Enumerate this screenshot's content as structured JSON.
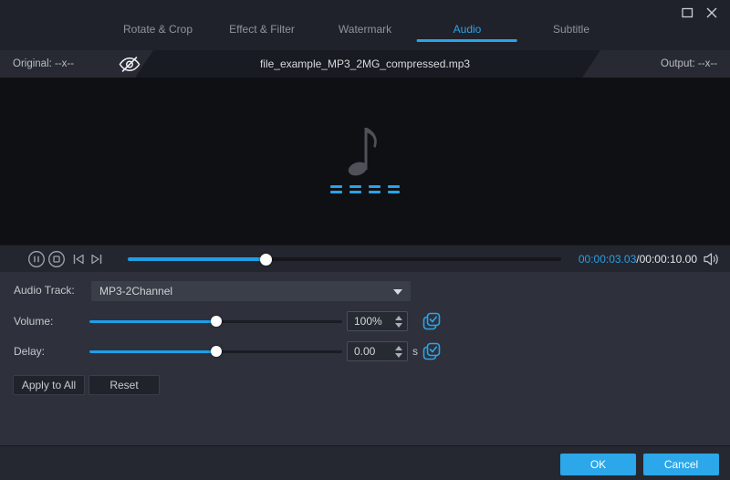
{
  "colors": {
    "accent": "#2ba4e8",
    "slider_blue": "#1e9fe6"
  },
  "tabs": [
    {
      "label": "Rotate & Crop",
      "active": false
    },
    {
      "label": "Effect & Filter",
      "active": false
    },
    {
      "label": "Watermark",
      "active": false
    },
    {
      "label": "Audio",
      "active": true
    },
    {
      "label": "Subtitle",
      "active": false
    }
  ],
  "file_bar": {
    "original_label": "Original: --x--",
    "filename": "file_example_MP3_2MG_compressed.mp3",
    "output_label": "Output: --x--"
  },
  "player": {
    "current_time": "00:00:03.03",
    "separator": "/",
    "total_time": "00:00:10.00",
    "progress_percent": 32
  },
  "settings": {
    "audio_track": {
      "label": "Audio Track:",
      "value": "MP3-2Channel"
    },
    "volume": {
      "label": "Volume:",
      "value": "100%",
      "slider_percent": 50.2
    },
    "delay": {
      "label": "Delay:",
      "value": "0.00",
      "unit": "s",
      "slider_percent": 50.2
    },
    "apply_to_all_label": "Apply to All",
    "reset_label": "Reset"
  },
  "footer": {
    "ok_label": "OK",
    "cancel_label": "Cancel"
  }
}
